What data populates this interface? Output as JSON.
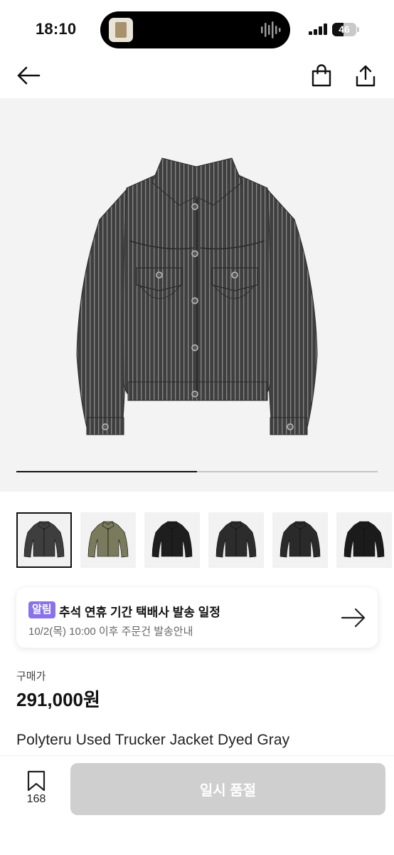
{
  "status_bar": {
    "time": "18:10",
    "battery": "46",
    "battery_level": 0.46
  },
  "nav": {
    "back_icon": "arrow-left-icon",
    "bag_icon": "shopping-bag-icon",
    "share_icon": "share-icon"
  },
  "gallery": {
    "progress": 0.5,
    "background": "#f3f3f3",
    "thumbnails": [
      {
        "name": "thumb-gray-pinstripe",
        "color": "#3e3e3e",
        "selected": true
      },
      {
        "name": "thumb-camo",
        "color": "#7a7a5c",
        "selected": false
      },
      {
        "name": "thumb-black",
        "color": "#1e1e1e",
        "selected": false
      },
      {
        "name": "thumb-dark-gray",
        "color": "#2c2c2c",
        "selected": false
      },
      {
        "name": "thumb-charcoal",
        "color": "#2a2a2a",
        "selected": false
      },
      {
        "name": "thumb-black-2",
        "color": "#1b1b1b",
        "selected": false
      }
    ]
  },
  "notice": {
    "badge": "알림",
    "badge_color": "#8a73e8",
    "title": "추석 연휴 기간 택배사 발송 일정",
    "subtitle": "10/2(목) 10:00 이후 주문건 발송안내"
  },
  "price": {
    "label": "구매가",
    "value": "291,000원"
  },
  "product": {
    "name": "Polyteru Used Trucker Jacket Dyed Gray"
  },
  "bottom": {
    "bookmark_count": "168",
    "buy_button": "일시 품절",
    "buy_button_color": "#cfcfcf"
  }
}
